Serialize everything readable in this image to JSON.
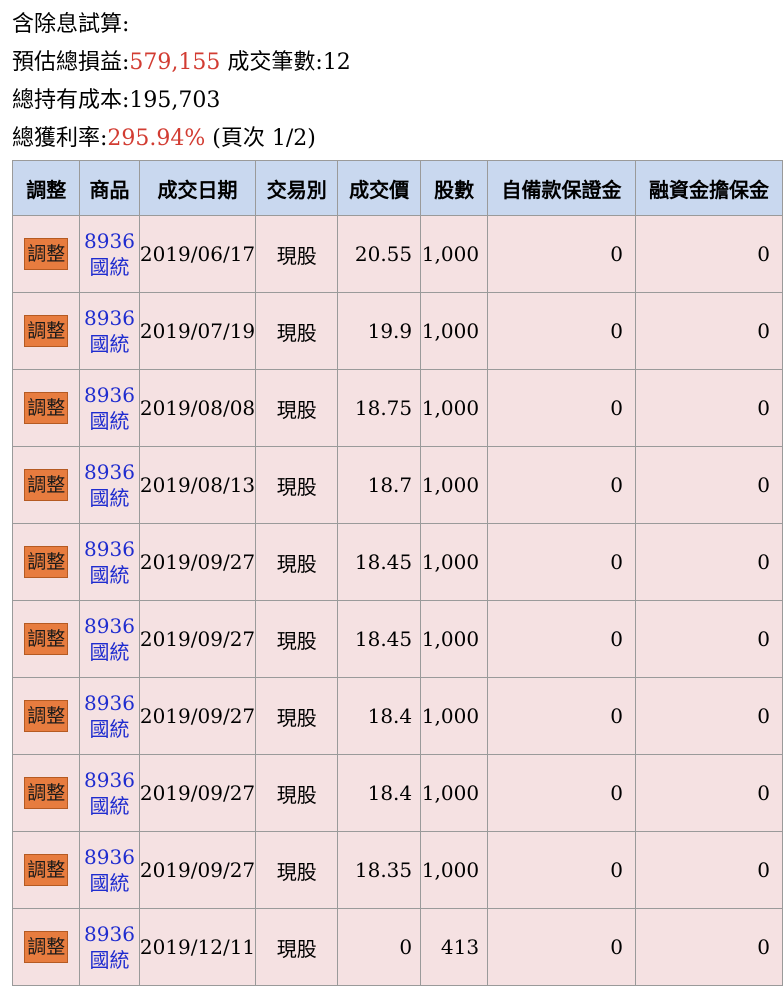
{
  "summary": {
    "title": "含除息試算:",
    "profit_label": "預估總損益:",
    "profit_value": "579,155",
    "count_label": " 成交筆數:",
    "count_value": "12",
    "cost_label": "總持有成本:",
    "cost_value": "195,703",
    "rate_label": "總獲利率:",
    "rate_value": "295.94%",
    "page_info": " (頁次 1/2)"
  },
  "table": {
    "headers": [
      "調整",
      "商品",
      "成交日期",
      "交易別",
      "成交價",
      "股數",
      "自備款保證金",
      "融資金擔保金"
    ],
    "rows": [
      {
        "action": "調整",
        "code": "8936",
        "name": "國統",
        "date": "2019/06/17",
        "type": "現股",
        "price": "20.55",
        "shares": "1,000",
        "margin": "0",
        "loan": "0"
      },
      {
        "action": "調整",
        "code": "8936",
        "name": "國統",
        "date": "2019/07/19",
        "type": "現股",
        "price": "19.9",
        "shares": "1,000",
        "margin": "0",
        "loan": "0"
      },
      {
        "action": "調整",
        "code": "8936",
        "name": "國統",
        "date": "2019/08/08",
        "type": "現股",
        "price": "18.75",
        "shares": "1,000",
        "margin": "0",
        "loan": "0"
      },
      {
        "action": "調整",
        "code": "8936",
        "name": "國統",
        "date": "2019/08/13",
        "type": "現股",
        "price": "18.7",
        "shares": "1,000",
        "margin": "0",
        "loan": "0"
      },
      {
        "action": "調整",
        "code": "8936",
        "name": "國統",
        "date": "2019/09/27",
        "type": "現股",
        "price": "18.45",
        "shares": "1,000",
        "margin": "0",
        "loan": "0"
      },
      {
        "action": "調整",
        "code": "8936",
        "name": "國統",
        "date": "2019/09/27",
        "type": "現股",
        "price": "18.45",
        "shares": "1,000",
        "margin": "0",
        "loan": "0"
      },
      {
        "action": "調整",
        "code": "8936",
        "name": "國統",
        "date": "2019/09/27",
        "type": "現股",
        "price": "18.4",
        "shares": "1,000",
        "margin": "0",
        "loan": "0"
      },
      {
        "action": "調整",
        "code": "8936",
        "name": "國統",
        "date": "2019/09/27",
        "type": "現股",
        "price": "18.4",
        "shares": "1,000",
        "margin": "0",
        "loan": "0"
      },
      {
        "action": "調整",
        "code": "8936",
        "name": "國統",
        "date": "2019/09/27",
        "type": "現股",
        "price": "18.35",
        "shares": "1,000",
        "margin": "0",
        "loan": "0"
      },
      {
        "action": "調整",
        "code": "8936",
        "name": "國統",
        "date": "2019/12/11",
        "type": "現股",
        "price": "0",
        "shares": "413",
        "margin": "0",
        "loan": "0"
      }
    ]
  },
  "colors": {
    "header_bg": "#c9d8ef",
    "row_bg": "#f5e1e2",
    "button_bg": "#e77c3f",
    "highlight_text": "#d23c32",
    "link_text": "#1f2ccf"
  }
}
